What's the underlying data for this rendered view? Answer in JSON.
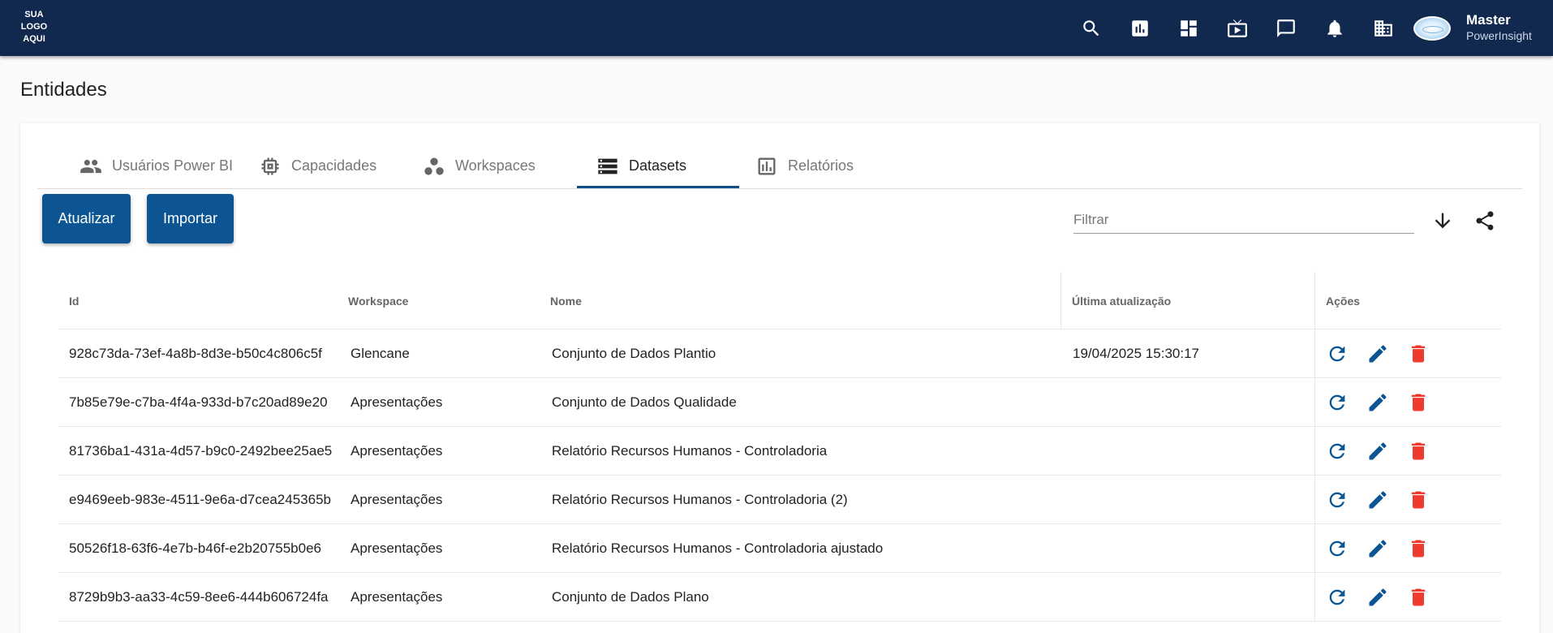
{
  "header": {
    "logo_line1": "SUA",
    "logo_line2": "LOGO",
    "logo_line3": "AQUI",
    "user_name": "Master",
    "user_org": "PowerInsight",
    "icons": [
      "search-icon",
      "report-icon",
      "dashboard-icon",
      "presentation-icon",
      "chat-icon",
      "notification-bell-icon",
      "organization-icon"
    ]
  },
  "page": {
    "title": "Entidades"
  },
  "tabs": [
    {
      "label": "Usuários Power BI",
      "icon": "people-icon",
      "active": false
    },
    {
      "label": "Capacidades",
      "icon": "chip-icon",
      "active": false
    },
    {
      "label": "Workspaces",
      "icon": "workspaces-icon",
      "active": false
    },
    {
      "label": "Datasets",
      "icon": "storage-icon",
      "active": true
    },
    {
      "label": "Relatórios",
      "icon": "bar-chart-icon",
      "active": false
    }
  ],
  "toolbar": {
    "refresh_label": "Atualizar",
    "import_label": "Importar",
    "filter_placeholder": "Filtrar",
    "filter_value": ""
  },
  "table": {
    "columns": [
      "Id",
      "Workspace",
      "Nome",
      "Última atualização",
      "Ações"
    ],
    "rows": [
      {
        "id": "928c73da-73ef-4a8b-8d3e-b50c4c806c5f",
        "workspace": "Glencane",
        "name": "Conjunto de Dados Plantio",
        "updated": "19/04/2025 15:30:17"
      },
      {
        "id": "7b85e79e-c7ba-4f4a-933d-b7c20ad89e20",
        "workspace": "Apresentações",
        "name": "Conjunto de Dados Qualidade",
        "updated": ""
      },
      {
        "id": "81736ba1-431a-4d57-b9c0-2492bee25ae5",
        "workspace": "Apresentações",
        "name": "Relatório Recursos Humanos - Controladoria",
        "updated": ""
      },
      {
        "id": "e9469eeb-983e-4511-9e6a-d7cea245365b",
        "workspace": "Apresentações",
        "name": "Relatório Recursos Humanos - Controladoria (2)",
        "updated": ""
      },
      {
        "id": "50526f18-63f6-4e7b-b46f-e2b20755b0e6",
        "workspace": "Apresentações",
        "name": "Relatório Recursos Humanos - Controladoria ajustado",
        "updated": ""
      },
      {
        "id": "8729b9b3-aa33-4c59-8ee6-444b606724fa",
        "workspace": "Apresentações",
        "name": "Conjunto de Dados Plano",
        "updated": ""
      }
    ]
  },
  "colors": {
    "topbar": "#11294f",
    "primary": "#0c5592",
    "delete": "#ef3a2f"
  }
}
